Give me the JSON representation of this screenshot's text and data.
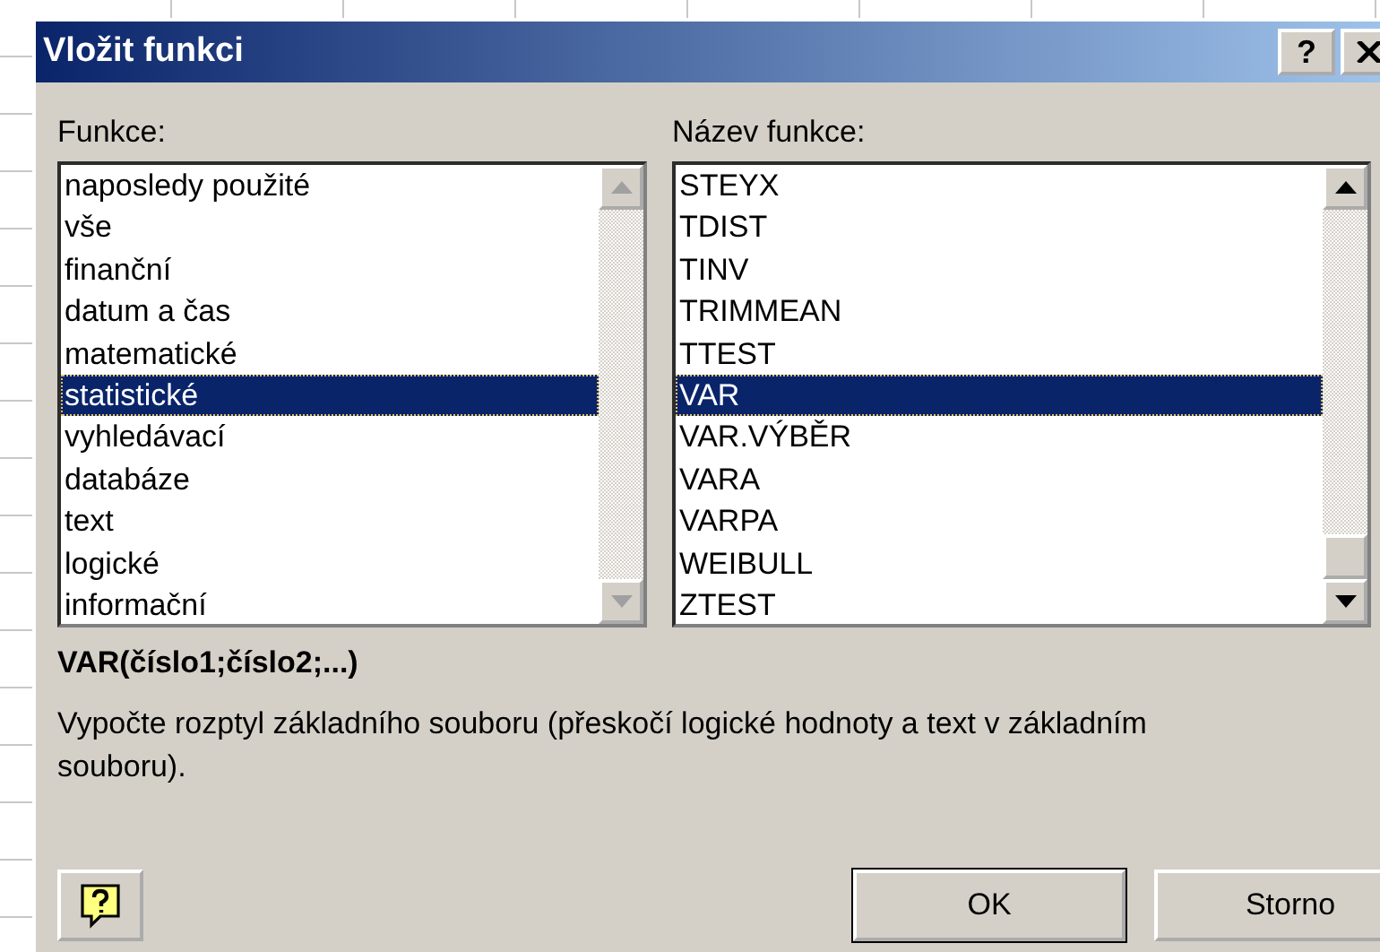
{
  "window": {
    "title": "Vložit funkci",
    "help_button": "?"
  },
  "category": {
    "label": "Funkce:",
    "scroll_disabled": true,
    "items": [
      {
        "label": "naposledy použité",
        "selected": false
      },
      {
        "label": "vše",
        "selected": false
      },
      {
        "label": "finanční",
        "selected": false
      },
      {
        "label": "datum a čas",
        "selected": false
      },
      {
        "label": "matematické",
        "selected": false
      },
      {
        "label": "statistické",
        "selected": true
      },
      {
        "label": "vyhledávací",
        "selected": false
      },
      {
        "label": "databáze",
        "selected": false
      },
      {
        "label": "text",
        "selected": false
      },
      {
        "label": "logické",
        "selected": false
      },
      {
        "label": "informační",
        "selected": false
      }
    ]
  },
  "functions": {
    "label": "Název funkce:",
    "scroll_disabled": false,
    "items": [
      {
        "label": "STEYX",
        "selected": false
      },
      {
        "label": "TDIST",
        "selected": false
      },
      {
        "label": "TINV",
        "selected": false
      },
      {
        "label": "TRIMMEAN",
        "selected": false
      },
      {
        "label": "TTEST",
        "selected": false
      },
      {
        "label": "VAR",
        "selected": true
      },
      {
        "label": "VAR.VÝBĚR",
        "selected": false
      },
      {
        "label": "VARA",
        "selected": false
      },
      {
        "label": "VARPA",
        "selected": false
      },
      {
        "label": "WEIBULL",
        "selected": false
      },
      {
        "label": "ZTEST",
        "selected": false
      }
    ]
  },
  "syntax": "VAR(číslo1;číslo2;...)",
  "description": "Vypočte rozptyl základního souboru (přeskočí logické hodnoty a text v základním souboru).",
  "buttons": [
    "OK",
    "Storno"
  ]
}
